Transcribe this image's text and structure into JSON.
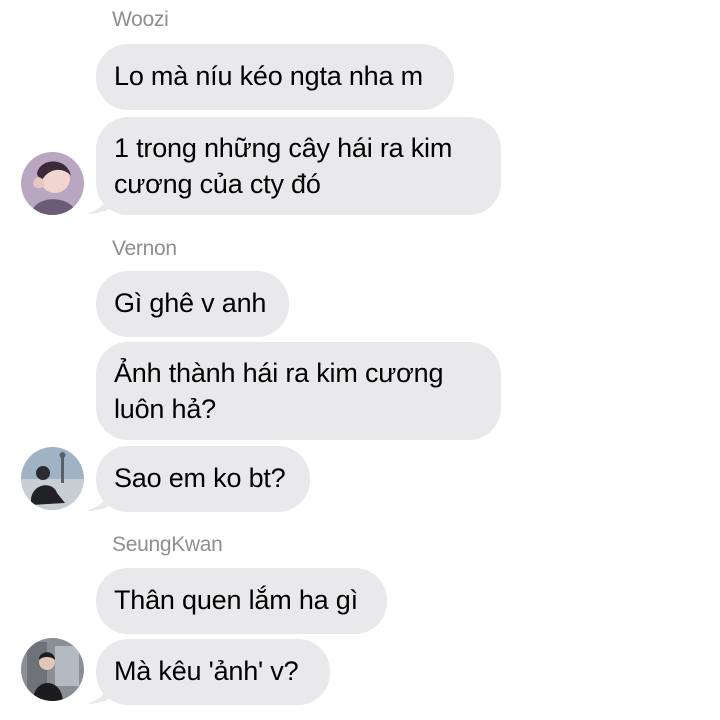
{
  "conversation": {
    "groups": [
      {
        "sender": "Woozi",
        "avatar": "avatar-woozi",
        "messages": [
          "Lo mà níu kéo ngta nha m",
          "1 trong những cây hái ra kim cương của cty đó"
        ]
      },
      {
        "sender": "Vernon",
        "avatar": "avatar-vernon",
        "messages": [
          "Gì ghê v anh",
          "Ảnh thành hái ra kim cương luôn hả?",
          "Sao em ko bt?"
        ]
      },
      {
        "sender": "SeungKwan",
        "avatar": "avatar-seungkwan",
        "messages": [
          "Thân quen lắm ha gì",
          "Mà kêu 'ảnh' v?"
        ]
      }
    ]
  },
  "colors": {
    "bubble": "#e9e9eb",
    "sender_name": "#8e8e93",
    "text": "#000000",
    "background": "#ffffff"
  }
}
